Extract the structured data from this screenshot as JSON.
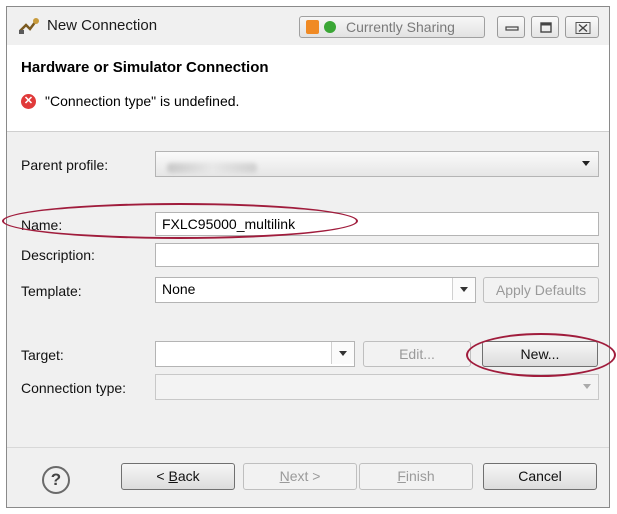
{
  "window": {
    "title": "New Connection",
    "sharing_status": "Currently Sharing",
    "controls": [
      "minimize-icon",
      "maximize-icon",
      "close-icon"
    ]
  },
  "header": {
    "title": "Hardware or Simulator Connection",
    "error_message": "\"Connection type\" is undefined."
  },
  "form": {
    "parent_profile_label": "Parent profile:",
    "name_label": "Name:",
    "name_value": "FXLC95000_multilink",
    "description_label": "Description:",
    "description_value": "",
    "template_label": "Template:",
    "template_value": "None",
    "apply_defaults_label": "Apply Defaults",
    "target_label": "Target:",
    "target_value": "",
    "edit_label": "Edit...",
    "new_label": "New...",
    "connection_type_label": "Connection type:",
    "connection_type_value": ""
  },
  "footer": {
    "help_icon": "help-icon",
    "back_prefix": "< ",
    "back_mnemonic": "B",
    "back_rest": "ack",
    "next_mnemonic": "N",
    "next_rest": "ext >",
    "finish_mnemonic": "F",
    "finish_rest": "inish",
    "cancel_label": "Cancel"
  },
  "colors": {
    "annotation_oval": "#a01c3c",
    "error_icon": "#e03a3a",
    "sharing_orange": "#f08a24",
    "sharing_green": "#3aa635"
  }
}
